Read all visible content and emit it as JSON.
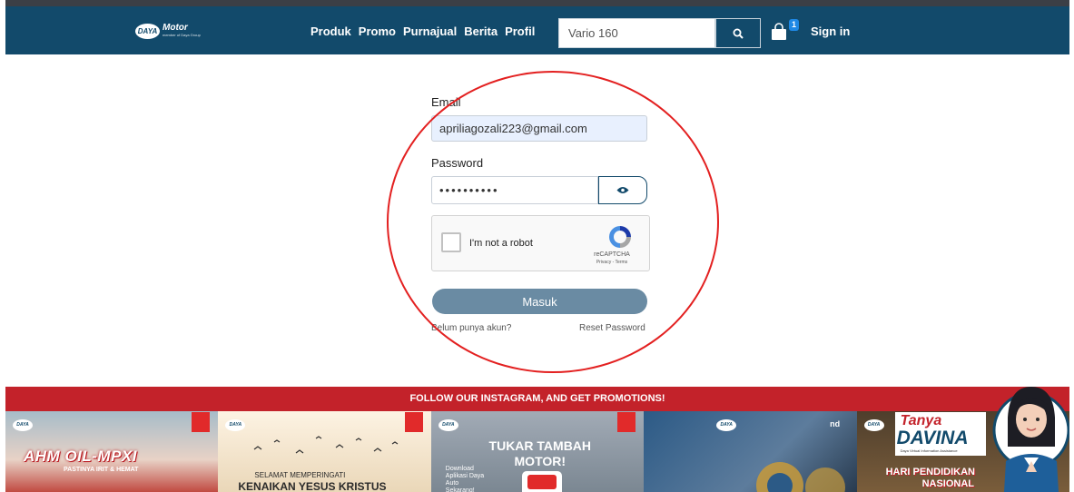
{
  "header": {
    "logo": {
      "mark": "DAYA",
      "name": "Motor",
      "tagline": "member of Daya Group"
    },
    "nav": [
      "Produk",
      "Promo",
      "Purnajual",
      "Berita",
      "Profil"
    ],
    "search": {
      "value": "Vario 160",
      "icon": "search-icon"
    },
    "cart": {
      "count": "1",
      "icon": "shopping-bag-icon"
    },
    "signin": "Sign in"
  },
  "form": {
    "email_label": "Email",
    "email_value": "apriliagozali223@gmail.com",
    "password_label": "Password",
    "password_value": "••••••••••",
    "toggle_icon": "eye-icon",
    "captcha": {
      "label": "I'm not a robot",
      "brand": "reCAPTCHA",
      "links": "Privacy - Terms"
    },
    "submit": "Masuk",
    "register_link": "Belum punya akun?",
    "reset_link": "Reset Password"
  },
  "promo": {
    "banner": "FOLLOW OUR INSTAGRAM, AND GET PROMOTIONS!",
    "tiles": [
      {
        "title": "AHM OIL-MPXI",
        "subtitle": "PASTINYA IRIT & HEMAT"
      },
      {
        "line1": "SELAMAT MEMPERINGATI",
        "line2": "KENAIKAN YESUS KRISTUS"
      },
      {
        "title": "TUKAR TAMBAH MOTOR!",
        "side": "Download Aplikasi Daya Auto Sekarang!"
      },
      {
        "caption": "nd"
      },
      {
        "line1": "Tanya",
        "line2": "DAVINA",
        "tagline": "Daya Virtual Information Assistance",
        "line3": "HARI PENDIDIKAN",
        "line4": "NASIONAL"
      }
    ]
  },
  "colors": {
    "navbar": "#124a6b",
    "banner": "#c3222a",
    "button": "#6a8ba3",
    "annotation": "#e32020"
  }
}
